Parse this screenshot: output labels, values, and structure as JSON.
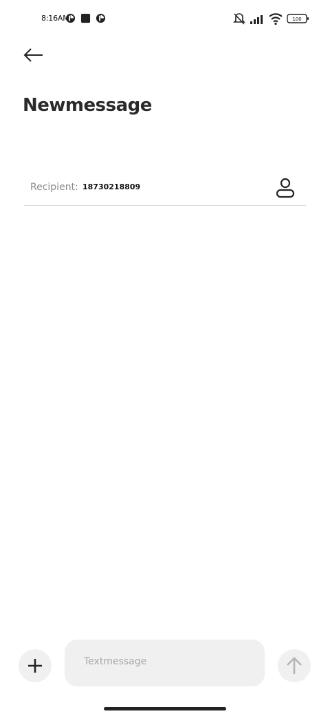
{
  "status_bar": {
    "time": "8:16AM",
    "battery": "100",
    "icons": [
      "app-notification-icon",
      "app-notification-icon",
      "app-notification-icon",
      "muted-vibrate-icon",
      "cellular-signal-icon",
      "wifi-icon",
      "battery-icon"
    ]
  },
  "header": {
    "back_icon": "arrow-left-icon",
    "title": "Newmessage"
  },
  "recipient": {
    "label": "Recipient:",
    "value": "18730218809",
    "contact_icon": "person-icon"
  },
  "composer": {
    "add_icon": "plus-icon",
    "placeholder": "Textmessage",
    "send_icon": "arrow-up-icon"
  },
  "colors": {
    "background": "#ffffff",
    "control_background": "#f0f0f0",
    "label_gray": "#888888",
    "divider": "#dcdcdc"
  }
}
